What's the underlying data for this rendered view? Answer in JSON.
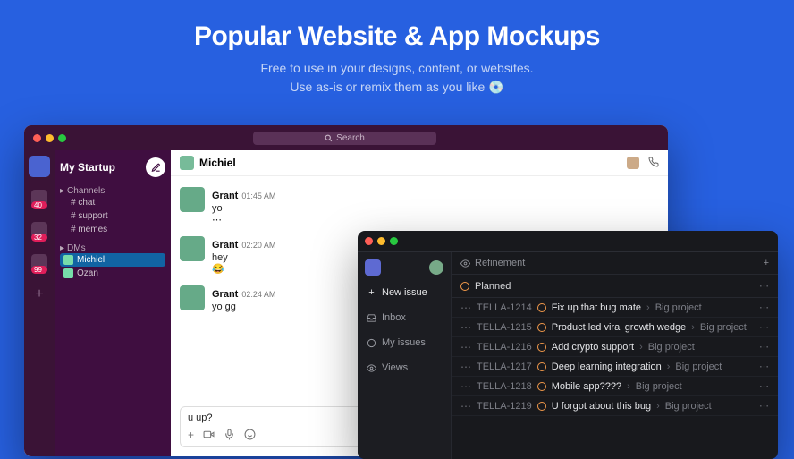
{
  "hero": {
    "title": "Popular Website & App Mockups",
    "line1": "Free to use in your designs, content, or websites.",
    "line2_prefix": "Use as-is or remix them as you like ",
    "emoji": "💿"
  },
  "slack": {
    "search_label": "Search",
    "workspace": "My Startup",
    "badges": {
      "a": "40",
      "b": "32",
      "c": "99"
    },
    "sections": {
      "channels_label": "Channels",
      "channels": [
        "chat",
        "support",
        "memes"
      ],
      "dms_label": "DMs",
      "dms": [
        {
          "name": "Michiel",
          "active": true
        },
        {
          "name": "Ozan",
          "active": false
        }
      ]
    },
    "chat_header": {
      "name": "Michiel"
    },
    "messages": [
      {
        "author": "Grant",
        "time": "01:45 AM",
        "text": "yo"
      },
      {
        "author": "Grant",
        "time": "02:20 AM",
        "text": "hey",
        "reaction": "😂"
      },
      {
        "author": "Grant",
        "time": "02:24 AM",
        "text": "yo gg"
      }
    ],
    "composer": {
      "value": "u up?"
    }
  },
  "linear": {
    "sidebar": {
      "new_issue": "New issue",
      "inbox": "Inbox",
      "my_issues": "My issues",
      "views": "Views"
    },
    "breadcrumb": "Refinement",
    "group": "Planned",
    "project": "Big project",
    "issues": [
      {
        "id": "TELLA-1214",
        "title": "Fix up that bug mate"
      },
      {
        "id": "TELLA-1215",
        "title": "Product led viral growth wedge"
      },
      {
        "id": "TELLA-1216",
        "title": "Add crypto support"
      },
      {
        "id": "TELLA-1217",
        "title": "Deep learning integration"
      },
      {
        "id": "TELLA-1218",
        "title": "Mobile app????"
      },
      {
        "id": "TELLA-1219",
        "title": "U forgot about this bug"
      }
    ]
  }
}
